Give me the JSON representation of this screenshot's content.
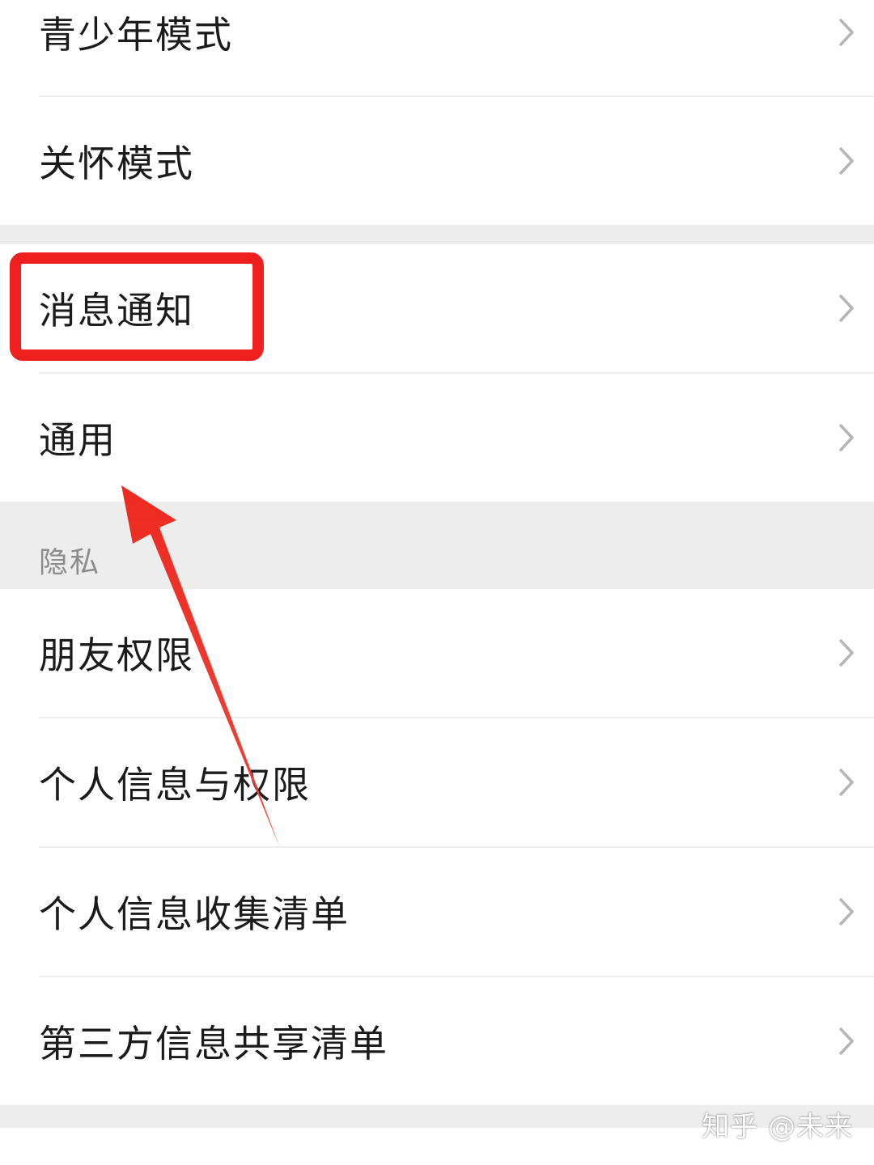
{
  "settings": {
    "rows": [
      {
        "label": "青少年模式"
      },
      {
        "label": "关怀模式"
      },
      {
        "label": "消息通知"
      },
      {
        "label": "通用"
      },
      {
        "label": "朋友权限"
      },
      {
        "label": "个人信息与权限"
      },
      {
        "label": "个人信息收集清单"
      },
      {
        "label": "第三方信息共享清单"
      }
    ],
    "privacy_header": "隐私"
  },
  "annotation": {
    "highlight_color": "#f0201e",
    "arrow_color": "#ec2d22"
  },
  "watermark": {
    "text": "知乎 @未来"
  },
  "icons": {
    "chevron": "chevron-right-icon"
  }
}
